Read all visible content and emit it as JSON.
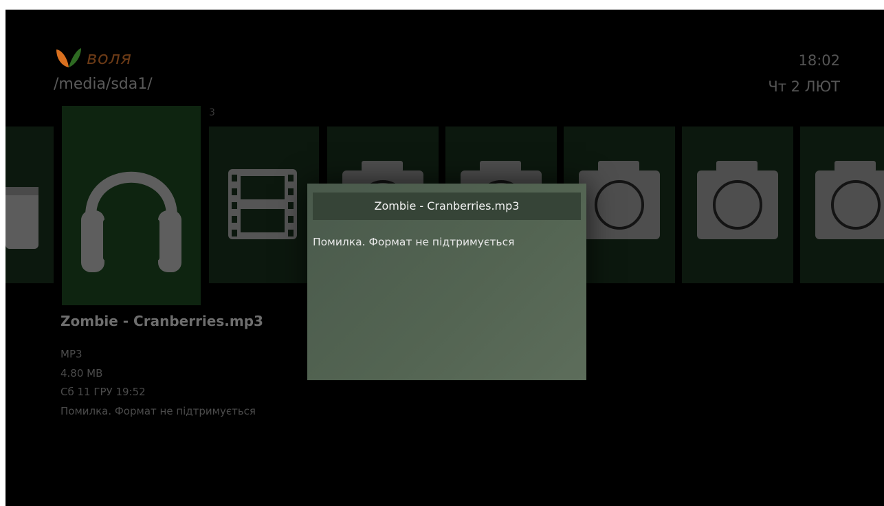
{
  "brand": {
    "logo_text": "воля",
    "accent_color": "#d9701f"
  },
  "header": {
    "path": "/media/sda1/"
  },
  "status": {
    "time": "18:02",
    "date": "Чт 2 ЛЮТ"
  },
  "carousel": {
    "counter": "3",
    "items": [
      {
        "type": "radio-icon"
      },
      {
        "type": "headphones-icon",
        "selected": true
      },
      {
        "type": "film-icon"
      },
      {
        "type": "camera-icon"
      },
      {
        "type": "camera-icon"
      },
      {
        "type": "camera-icon"
      },
      {
        "type": "camera-icon"
      },
      {
        "type": "camera-icon"
      }
    ]
  },
  "info": {
    "title": "Zombie - Cranberries.mp3",
    "format": "MP3",
    "size": "4.80 MB",
    "date": "Сб 11 ГРУ 19:52",
    "message": "Помилка. Формат не підтримується"
  },
  "dialog": {
    "title": "Zombie - Cranberries.mp3",
    "message": "Помилка. Формат не підтримується"
  }
}
